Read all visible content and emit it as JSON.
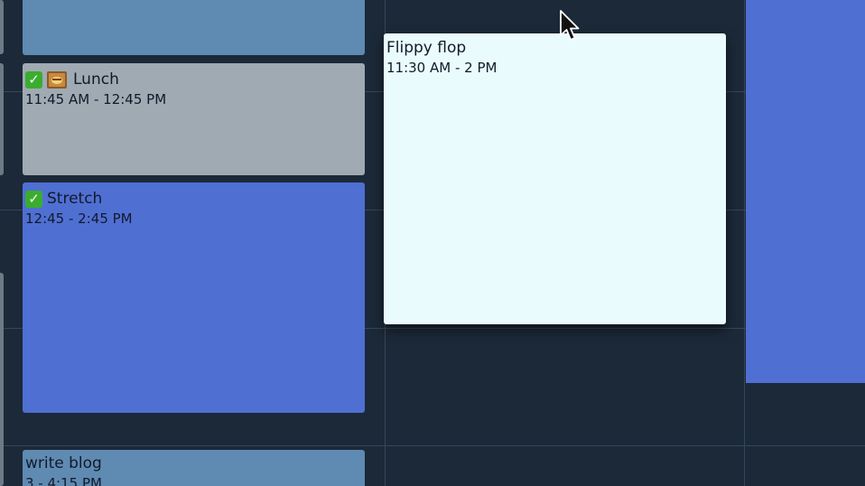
{
  "calendar": {
    "events": [
      {
        "id": "top-block",
        "title": "",
        "time": ""
      },
      {
        "id": "lunch",
        "title": "Lunch",
        "time": "11:45 AM - 12:45 PM",
        "completed": true,
        "icon": "food-icon"
      },
      {
        "id": "stretch",
        "title": "Stretch",
        "time": "12:45 - 2:45 PM",
        "completed": true
      },
      {
        "id": "write-blog",
        "title": "write blog",
        "time": "3 - 4:15 PM"
      }
    ],
    "dragging_event": {
      "title": "Flippy flop",
      "time": "11:30 AM - 2 PM"
    },
    "right_column_event": {
      "title": "",
      "time": ""
    }
  },
  "colors": {
    "background": "#1c2938",
    "gridline": "#34475a",
    "event_steel": "#5f8ab2",
    "event_gray": "#a0aab3",
    "event_blue": "#4f6fd3",
    "dragging_event": "#eafbfd",
    "check_green": "#3aad2e"
  },
  "icons": {
    "check": "check-mark-icon",
    "food": "food-icon",
    "cursor": "mouse-cursor-icon"
  }
}
